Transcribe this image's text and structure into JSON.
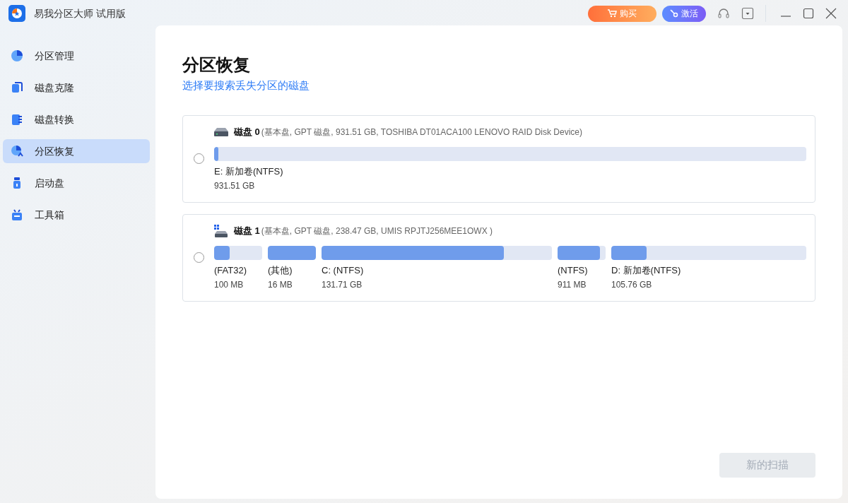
{
  "app": {
    "title": "易我分区大师 试用版",
    "buy_button": "购买",
    "activate_button": "激活"
  },
  "sidebar": {
    "items": [
      {
        "label": "分区管理",
        "selected": false
      },
      {
        "label": "磁盘克隆",
        "selected": false
      },
      {
        "label": "磁盘转换",
        "selected": false
      },
      {
        "label": "分区恢复",
        "selected": true
      },
      {
        "label": "启动盘",
        "selected": false
      },
      {
        "label": "工具箱",
        "selected": false
      }
    ]
  },
  "page": {
    "title": "分区恢复",
    "subtitle": "选择要搜索丢失分区的磁盘"
  },
  "disks": [
    {
      "name": "磁盘 0",
      "details": "(基本盘, GPT 磁盘, 931.51 GB, TOSHIBA DT01ACA100 LENOVO RAID Disk Device)",
      "kind": "hdd",
      "selected": false,
      "partitions": [
        {
          "label": "E: 新加卷(NTFS)",
          "size": "931.51 GB",
          "level": 0.007
        }
      ]
    },
    {
      "name": "磁盘 1",
      "details": "(基本盘, GPT 磁盘, 238.47 GB, UMIS RPJTJ256MEE1OWX )",
      "kind": "system",
      "selected": false,
      "partitions": [
        {
          "label": "(FAT32)",
          "size": "100 MB",
          "level": 0.32
        },
        {
          "label": "(其他)",
          "size": "16 MB",
          "level": 1
        },
        {
          "label": "C: (NTFS)",
          "size": "131.71 GB",
          "level": 0.79
        },
        {
          "label": "(NTFS)",
          "size": "911 MB",
          "level": 0.88
        },
        {
          "label": "D: 新加卷(NTFS)",
          "size": "105.76 GB",
          "level": 0.18
        }
      ]
    }
  ],
  "scan_button": {
    "label": "新的扫描",
    "disabled": true
  }
}
